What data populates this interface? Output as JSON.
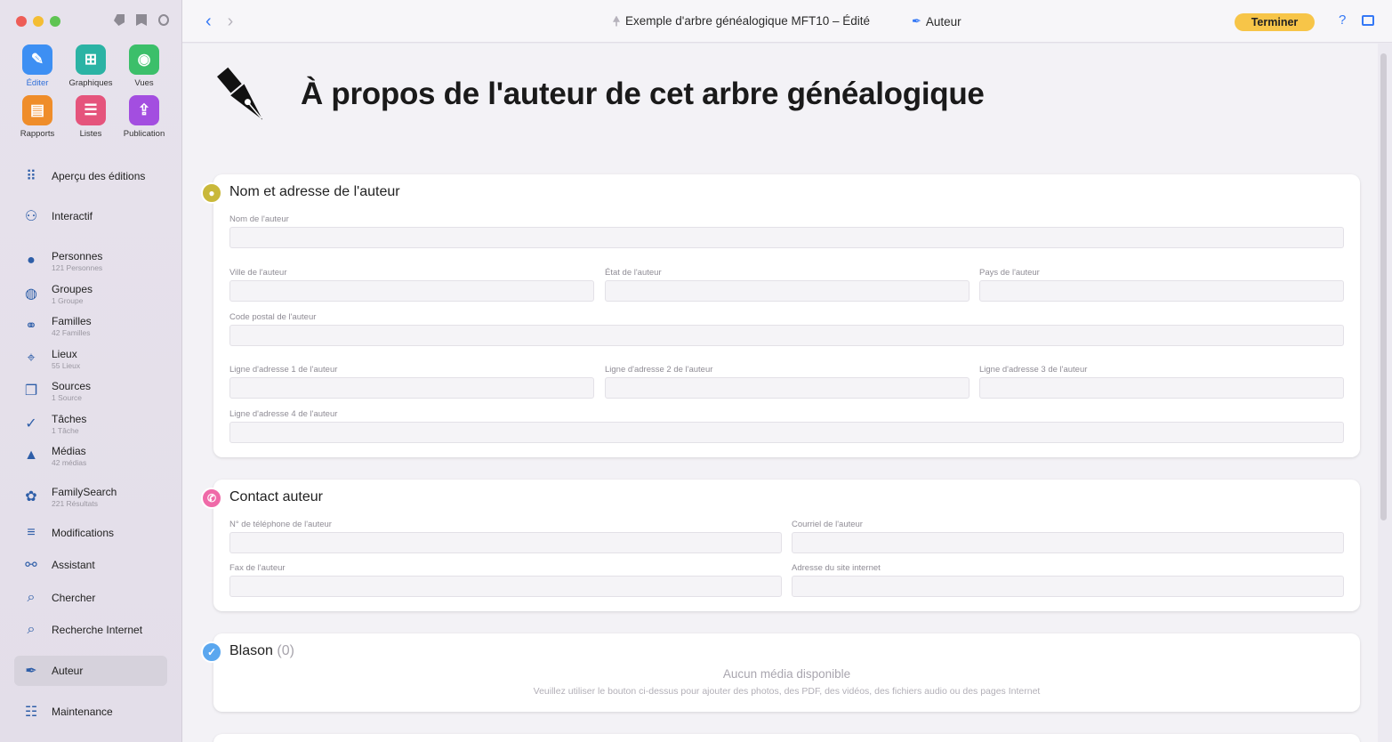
{
  "sidebar": {
    "apps": [
      {
        "label": "Éditer",
        "icon": "pencil-icon",
        "color": "#3d8ff3",
        "glyph": "✎",
        "label_color": "#2e6fd9"
      },
      {
        "label": "Graphiques",
        "icon": "chart-tree-icon",
        "color": "#2bb3a4",
        "glyph": "⊞",
        "label_color": "#333"
      },
      {
        "label": "Vues",
        "icon": "eye-icon",
        "color": "#3cbf6a",
        "glyph": "◉",
        "label_color": "#333"
      },
      {
        "label": "Rapports",
        "icon": "report-icon",
        "color": "#ef8d2a",
        "glyph": "▤",
        "label_color": "#333"
      },
      {
        "label": "Listes",
        "icon": "list-icon",
        "color": "#e5547c",
        "glyph": "☰",
        "label_color": "#333"
      },
      {
        "label": "Publication",
        "icon": "publish-icon",
        "color": "#a34ee0",
        "glyph": "⇪",
        "label_color": "#333"
      }
    ],
    "nav": [
      {
        "label": "Aperçu des éditions",
        "sub": "",
        "icon": "grid-icon",
        "glyph": "⠿"
      },
      {
        "label": "Interactif",
        "sub": "",
        "icon": "tree-icon",
        "glyph": "⚇"
      },
      {
        "label": "Personnes",
        "sub": "121 Personnes",
        "icon": "person-icon",
        "glyph": "●"
      },
      {
        "label": "Groupes",
        "sub": "1 Groupe",
        "icon": "group-icon",
        "glyph": "◍"
      },
      {
        "label": "Familles",
        "sub": "42 Familles",
        "icon": "rings-icon",
        "glyph": "⚭"
      },
      {
        "label": "Lieux",
        "sub": "55 Lieux",
        "icon": "pin-icon",
        "glyph": "⌖"
      },
      {
        "label": "Sources",
        "sub": "1 Source",
        "icon": "sources-icon",
        "glyph": "❐"
      },
      {
        "label": "Tâches",
        "sub": "1 Tâche",
        "icon": "checkmark-icon",
        "glyph": "✓"
      },
      {
        "label": "Médias",
        "sub": "42 médias",
        "icon": "media-icon",
        "glyph": "▲"
      },
      {
        "label": "FamilySearch",
        "sub": "221 Résultats",
        "icon": "familysearch-icon",
        "glyph": "✿"
      },
      {
        "label": "Modifications",
        "sub": "",
        "icon": "list-lines-icon",
        "glyph": "≡"
      },
      {
        "label": "Assistant",
        "sub": "",
        "icon": "assistant-icon",
        "glyph": "⚯"
      },
      {
        "label": "Chercher",
        "sub": "",
        "icon": "magnifier-icon",
        "glyph": "⌕"
      },
      {
        "label": "Recherche Internet",
        "sub": "",
        "icon": "globe-search-icon",
        "glyph": "⌕"
      },
      {
        "label": "Auteur",
        "sub": "",
        "icon": "fountain-pen-icon",
        "glyph": "✒"
      },
      {
        "label": "Maintenance",
        "sub": "",
        "icon": "maintenance-icon",
        "glyph": "☷"
      }
    ],
    "active": "Auteur"
  },
  "topbar": {
    "document_title": "Exemple d'arbre généalogique MFT10 – Édité",
    "breadcrumb": "Auteur",
    "finish_label": "Terminer",
    "help_label": "?"
  },
  "page": {
    "title": "À propos de l'auteur de cet arbre généalogique"
  },
  "sections": {
    "name_address": {
      "title": "Nom et adresse de l'auteur",
      "badge_color": "#c9b83a",
      "fields": {
        "name": {
          "label": "Nom de l'auteur",
          "value": ""
        },
        "city": {
          "label": "Ville de l'auteur",
          "value": ""
        },
        "state": {
          "label": "État de l'auteur",
          "value": ""
        },
        "country": {
          "label": "Pays de l'auteur",
          "value": ""
        },
        "postal": {
          "label": "Code postal de l'auteur",
          "value": ""
        },
        "addr1": {
          "label": "Ligne d'adresse 1 de l'auteur",
          "value": ""
        },
        "addr2": {
          "label": "Ligne d'adresse 2 de l'auteur",
          "value": ""
        },
        "addr3": {
          "label": "Ligne d'adresse 3 de l'auteur",
          "value": ""
        },
        "addr4": {
          "label": "Ligne d'adresse 4 de l'auteur",
          "value": ""
        }
      }
    },
    "contact": {
      "title": "Contact auteur",
      "badge_color": "#ef6aa8",
      "fields": {
        "phone": {
          "label": "N° de téléphone de l'auteur",
          "value": ""
        },
        "email": {
          "label": "Courriel de l'auteur",
          "value": ""
        },
        "fax": {
          "label": "Fax de l'auteur",
          "value": ""
        },
        "website": {
          "label": "Adresse du site internet",
          "value": ""
        }
      }
    },
    "crest": {
      "title": "Blason",
      "count": "(0)",
      "badge_color": "#5aa7ef",
      "empty_title": "Aucun média disponible",
      "empty_desc": "Veuillez utiliser le bouton ci-dessus pour ajouter des photos, des PDF, des vidéos, des fichiers audio ou des pages Internet"
    }
  }
}
